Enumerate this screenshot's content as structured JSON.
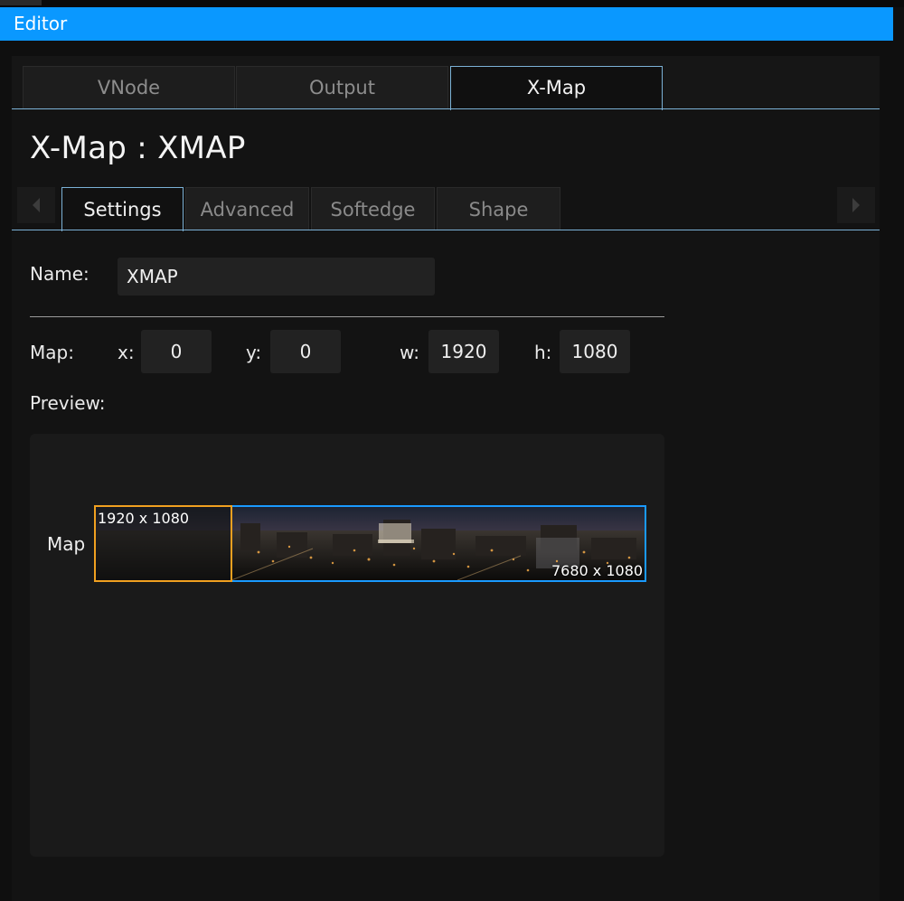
{
  "window": {
    "title": "Editor"
  },
  "main_tabs": [
    {
      "label": "VNode",
      "active": false
    },
    {
      "label": "Output",
      "active": false
    },
    {
      "label": "X-Map",
      "active": true
    }
  ],
  "page_title": "X-Map : XMAP",
  "sub_tabs": [
    {
      "label": "Settings",
      "active": true
    },
    {
      "label": "Advanced",
      "active": false
    },
    {
      "label": "Softedge",
      "active": false
    },
    {
      "label": "Shape",
      "active": false
    }
  ],
  "name_field": {
    "label": "Name:",
    "value": "XMAP"
  },
  "map_fields": {
    "label": "Map:",
    "x": {
      "label": "x:",
      "value": "0"
    },
    "y": {
      "label": "y:",
      "value": "0"
    },
    "w": {
      "label": "w:",
      "value": "1920"
    },
    "h": {
      "label": "h:",
      "value": "1080"
    }
  },
  "preview": {
    "label": "Preview:",
    "map_label": "Map",
    "window_size": "1920 x 1080",
    "canvas_size": "7680 x 1080"
  },
  "colors": {
    "titlebar": "#0a98ff",
    "tab_accent": "#7bb1d6",
    "map_outline": "#1a9aff",
    "window_outline": "#f0a020"
  },
  "icons": {
    "scroll_left": "triangle-left-icon",
    "scroll_right": "triangle-right-icon"
  }
}
